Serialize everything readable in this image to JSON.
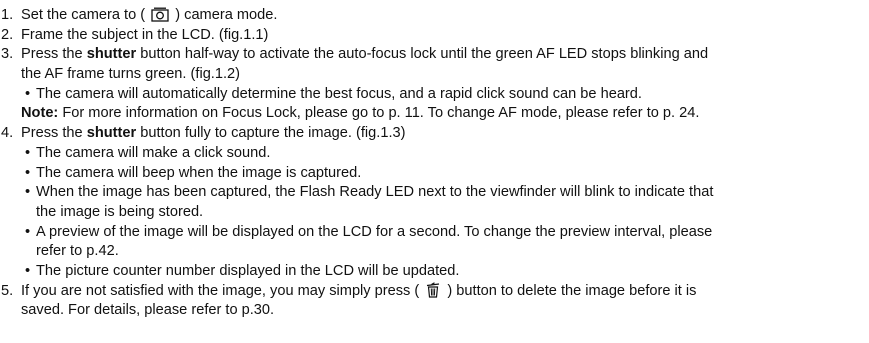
{
  "steps": [
    {
      "num": "1.",
      "before": "Set the camera to (",
      "icon": "camera-mode-icon",
      "after": ") camera mode."
    },
    {
      "num": "2.",
      "text": "Frame the subject in the LCD. (fig.1.1)"
    },
    {
      "num": "3.",
      "pre": "Press the ",
      "bold": "shutter",
      "line1": " button half-way to activate the auto-focus lock until the green AF LED stops blinking and",
      "line2": "the AF frame turns green. (fig.1.2)"
    },
    {
      "num": "4.",
      "pre": "Press the ",
      "bold": "shutter",
      "post": " button fully to capture the image. (fig.1.3)"
    },
    {
      "num": "5.",
      "before": "If you are not satisfied with the image, you may simply press (",
      "icon": "trash-icon",
      "after": ") button to delete the image before it is",
      "line2": "saved. For details, please refer to p.30."
    }
  ],
  "step3_bullet": "The camera will automatically determine the best focus, and a rapid click sound can be heard.",
  "note": {
    "label": "Note:",
    "text": " For more information on Focus Lock, please go to p. 11. To change AF mode, please refer to p. 24."
  },
  "step4_bullets": [
    {
      "line1": "The camera will make a click sound."
    },
    {
      "line1": "The camera will beep when the image is captured."
    },
    {
      "line1": "When the image has been captured, the Flash Ready LED next to the viewfinder will blink to indicate that",
      "line2": "the image is being stored."
    },
    {
      "line1": "A preview of the image will be displayed on the LCD for a second. To change the preview interval, please",
      "line2": "refer to p.42."
    },
    {
      "line1": "The picture counter number displayed in the LCD will be updated."
    }
  ],
  "bullet_char": "•"
}
